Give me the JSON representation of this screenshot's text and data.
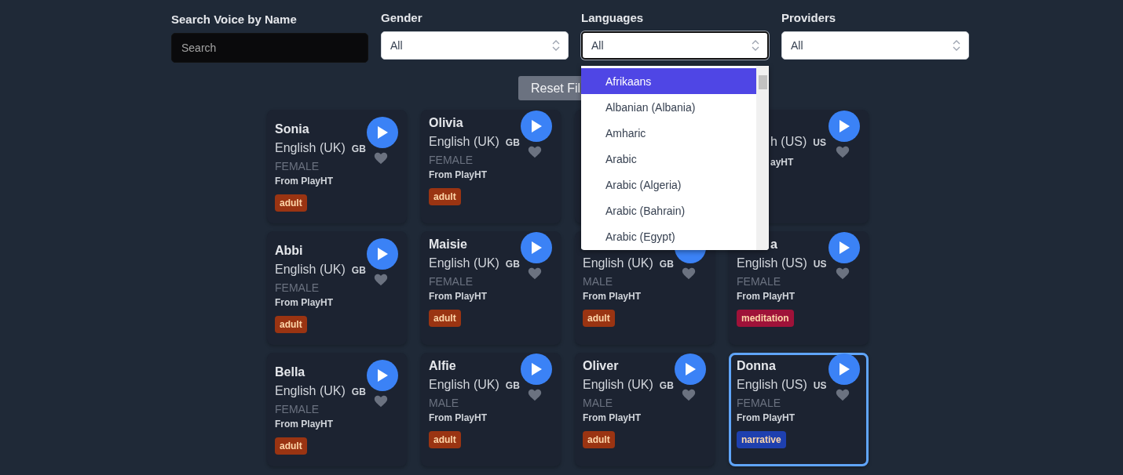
{
  "filters": [
    {
      "kind": "search",
      "label": "Search Voice by Name",
      "placeholder": "Search"
    },
    {
      "kind": "select",
      "label": "Gender",
      "value": "All",
      "open": false
    },
    {
      "kind": "select",
      "label": "Languages",
      "value": "All",
      "open": true,
      "options": [
        {
          "label": "Afrikaans",
          "selected": true
        },
        {
          "label": "Albanian (Albania)",
          "selected": false
        },
        {
          "label": "Amharic",
          "selected": false
        },
        {
          "label": "Arabic",
          "selected": false
        },
        {
          "label": "Arabic (Algeria)",
          "selected": false
        },
        {
          "label": "Arabic (Bahrain)",
          "selected": false
        },
        {
          "label": "Arabic (Egypt)",
          "selected": false
        }
      ]
    },
    {
      "kind": "select",
      "label": "Providers",
      "value": "All",
      "open": false
    }
  ],
  "reset_button": "Reset Fil",
  "voices": [
    {
      "name": "Sonia",
      "language": "English (UK)",
      "country": "GB",
      "gender": "FEMALE",
      "source": "From PlayHT",
      "tag": "adult",
      "color": "#9a3412",
      "selected": false
    },
    {
      "name": "Olivia",
      "language": "English (UK)",
      "country": "GB",
      "gender": "FEMALE",
      "source": "From PlayHT",
      "tag": "adult",
      "color": "#9a3412",
      "selected": false
    },
    {
      "selected": false
    },
    {
      "language": "h (US)",
      "country": "US",
      "source": "ayHT",
      "selected": false
    },
    {
      "name": "Abbi",
      "language": "English (UK)",
      "country": "GB",
      "gender": "FEMALE",
      "source": "From PlayHT",
      "tag": "adult",
      "color": "#9a3412",
      "selected": false
    },
    {
      "name": "Maisie",
      "language": "English (UK)",
      "country": "GB",
      "gender": "FEMALE",
      "source": "From PlayHT",
      "tag": "adult",
      "color": "#9a3412",
      "selected": false
    },
    {
      "language": "English (UK)",
      "country": "GB",
      "gender": "MALE",
      "source": "From PlayHT",
      "tag": "adult",
      "color": "#9a3412",
      "selected": false
    },
    {
      "name": "a",
      "language": "English (US)",
      "country": "US",
      "gender": "FEMALE",
      "source": "From PlayHT",
      "tag": "meditation",
      "color": "#9f1239",
      "selected": false
    },
    {
      "name": "Bella",
      "language": "English (UK)",
      "country": "GB",
      "gender": "FEMALE",
      "source": "From PlayHT",
      "tag": "adult",
      "color": "#9a3412",
      "selected": false
    },
    {
      "name": "Alfie",
      "language": "English (UK)",
      "country": "GB",
      "gender": "MALE",
      "source": "From PlayHT",
      "tag": "adult",
      "color": "#9a3412",
      "selected": false
    },
    {
      "name": "Oliver",
      "language": "English (UK)",
      "country": "GB",
      "gender": "MALE",
      "source": "From PlayHT",
      "tag": "adult",
      "color": "#9a3412",
      "selected": false
    },
    {
      "name": "Donna",
      "language": "English (US)",
      "country": "US",
      "gender": "FEMALE",
      "source": "From PlayHT",
      "tag": "narrative",
      "color": "#1e40af",
      "selected": true
    }
  ]
}
